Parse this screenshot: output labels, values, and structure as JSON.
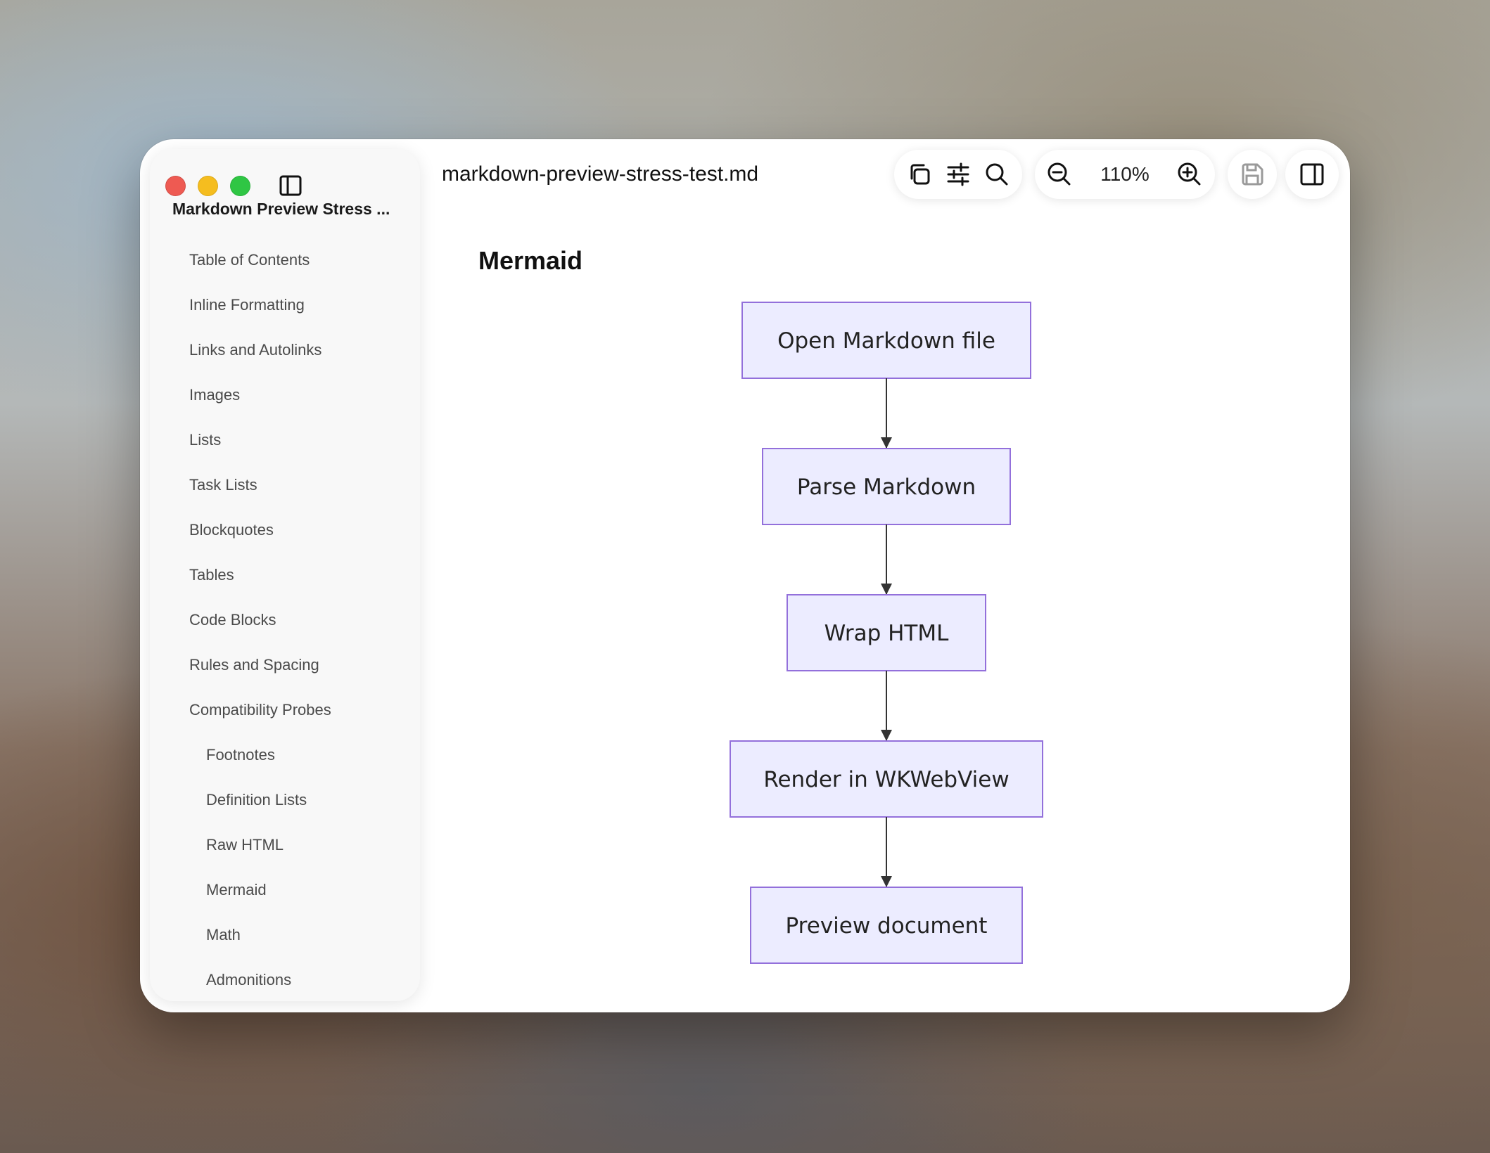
{
  "window": {
    "filename": "markdown-preview-stress-test.md",
    "zoom_level": "110%"
  },
  "sidebar": {
    "document_title": "Markdown Preview Stress ...",
    "toc": [
      {
        "label": "Table of Contents",
        "level": 1
      },
      {
        "label": "Inline Formatting",
        "level": 1
      },
      {
        "label": "Links and Autolinks",
        "level": 1
      },
      {
        "label": "Images",
        "level": 1
      },
      {
        "label": "Lists",
        "level": 1
      },
      {
        "label": "Task Lists",
        "level": 1
      },
      {
        "label": "Blockquotes",
        "level": 1
      },
      {
        "label": "Tables",
        "level": 1
      },
      {
        "label": "Code Blocks",
        "level": 1
      },
      {
        "label": "Rules and Spacing",
        "level": 1
      },
      {
        "label": "Compatibility Probes",
        "level": 1
      },
      {
        "label": "Footnotes",
        "level": 2
      },
      {
        "label": "Definition Lists",
        "level": 2
      },
      {
        "label": "Raw HTML",
        "level": 2
      },
      {
        "label": "Mermaid",
        "level": 2
      },
      {
        "label": "Math",
        "level": 2
      },
      {
        "label": "Admonitions",
        "level": 2
      }
    ]
  },
  "toolbar": {
    "icons": [
      "copy-icon",
      "sliders-icon",
      "search-icon",
      "zoom-out-icon",
      "zoom-in-icon",
      "save-icon",
      "inspector-toggle-icon"
    ]
  },
  "content": {
    "heading": "Mermaid",
    "flowchart": {
      "nodes": [
        "Open Markdown file",
        "Parse Markdown",
        "Wrap HTML",
        "Render in WKWebView",
        "Preview document"
      ],
      "node_fill": "#ececff",
      "node_stroke": "#9370db",
      "edge_color": "#333333"
    }
  },
  "colors": {
    "close": "#ee5a52",
    "minimize": "#f5bd1f",
    "maximize": "#2fc644"
  }
}
